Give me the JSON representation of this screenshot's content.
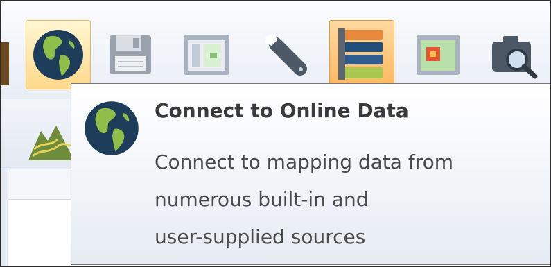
{
  "toolbar": {
    "tools": [
      {
        "name": "connect-online-data",
        "icon": "globe-icon",
        "state": "hover"
      },
      {
        "name": "save",
        "icon": "floppy-disk-icon"
      },
      {
        "name": "layout",
        "icon": "layout-panel-icon"
      },
      {
        "name": "settings",
        "icon": "wrench-icon"
      },
      {
        "name": "layers",
        "icon": "layer-stack-icon",
        "state": "pressed"
      },
      {
        "name": "map-frame",
        "icon": "map-frame-icon"
      },
      {
        "name": "inspect",
        "icon": "camera-search-icon"
      }
    ]
  },
  "second_row": {
    "icons": [
      "terrain-icon"
    ]
  },
  "tooltip": {
    "icon": "globe-icon",
    "title": "Connect to Online Data",
    "description_lines": [
      "Connect to mapping data from",
      "numerous built-in and",
      "user-supplied sources"
    ]
  },
  "colors": {
    "hover_highlight": "#ffd98a",
    "pressed_highlight": "#ffb75e",
    "globe_ocean": "#1d3d5a",
    "globe_land": "#8fbf4a"
  }
}
